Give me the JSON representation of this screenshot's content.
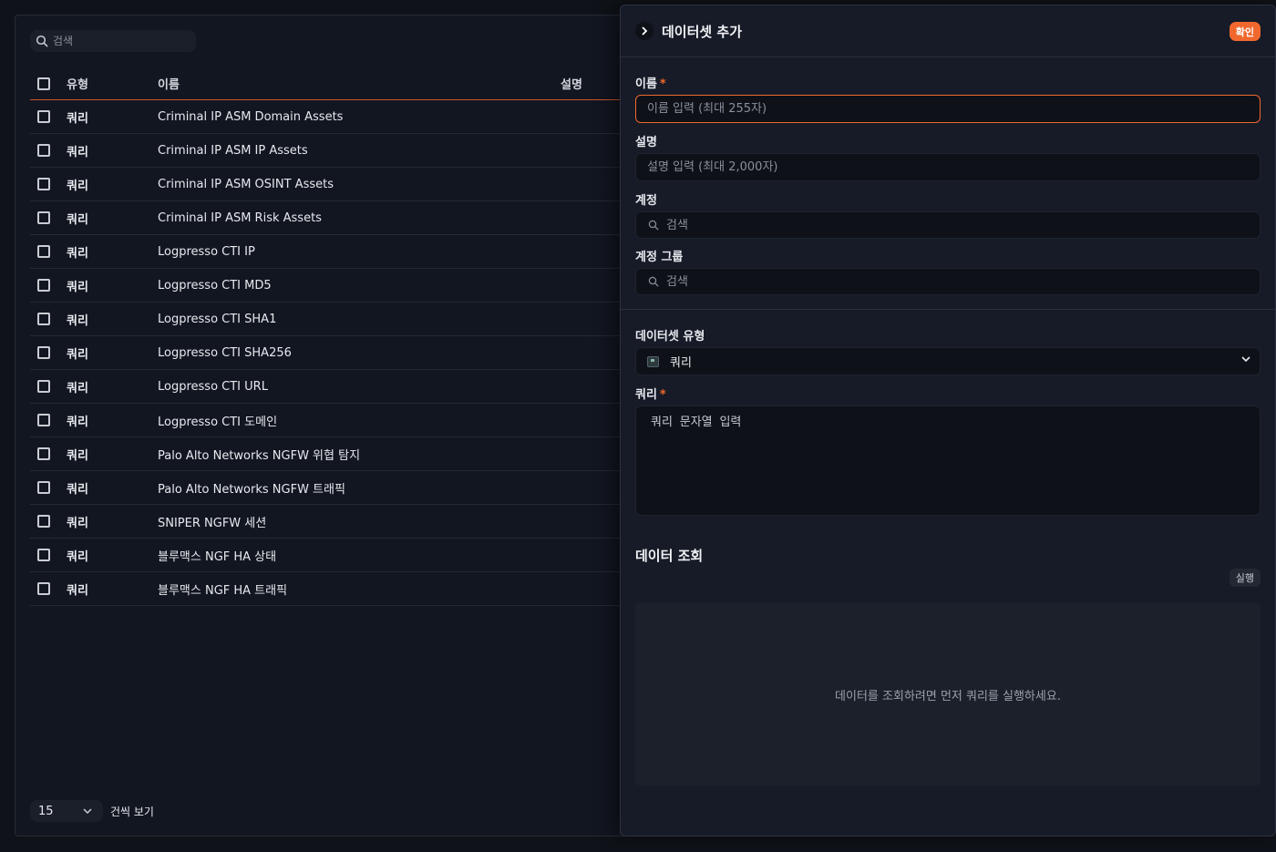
{
  "list": {
    "search_placeholder": "검색",
    "columns": {
      "type": "유형",
      "name": "이름",
      "description": "설명"
    },
    "rows": [
      {
        "type": "쿼리",
        "name": "Criminal IP ASM Domain Assets",
        "description": ""
      },
      {
        "type": "쿼리",
        "name": "Criminal IP ASM IP Assets",
        "description": ""
      },
      {
        "type": "쿼리",
        "name": "Criminal IP ASM OSINT Assets",
        "description": ""
      },
      {
        "type": "쿼리",
        "name": "Criminal IP ASM Risk Assets",
        "description": ""
      },
      {
        "type": "쿼리",
        "name": "Logpresso CTI IP",
        "description": ""
      },
      {
        "type": "쿼리",
        "name": "Logpresso CTI MD5",
        "description": ""
      },
      {
        "type": "쿼리",
        "name": "Logpresso CTI SHA1",
        "description": ""
      },
      {
        "type": "쿼리",
        "name": "Logpresso CTI SHA256",
        "description": ""
      },
      {
        "type": "쿼리",
        "name": "Logpresso CTI URL",
        "description": ""
      },
      {
        "type": "쿼리",
        "name": "Logpresso CTI 도메인",
        "description": ""
      },
      {
        "type": "쿼리",
        "name": "Palo Alto Networks NGFW 위협 탐지",
        "description": ""
      },
      {
        "type": "쿼리",
        "name": "Palo Alto Networks NGFW 트래픽",
        "description": ""
      },
      {
        "type": "쿼리",
        "name": "SNIPER NGFW 세션",
        "description": ""
      },
      {
        "type": "쿼리",
        "name": "블루맥스 NGF HA 상태",
        "description": ""
      },
      {
        "type": "쿼리",
        "name": "블루맥스 NGF HA 트래픽",
        "description": ""
      }
    ],
    "page_size": "15",
    "page_size_label": "건씩 보기"
  },
  "form": {
    "title": "데이터셋 추가",
    "confirm_label": "확인",
    "name_label": "이름",
    "required_mark": "*",
    "name_placeholder": "이름 입력 (최대 255자)",
    "description_label": "설명",
    "description_placeholder": "설명 입력 (최대 2,000자)",
    "account_label": "계정",
    "account_search_placeholder": "검색",
    "account_group_label": "계정 그룹",
    "account_group_search_placeholder": "검색",
    "dataset_type_label": "데이터셋 유형",
    "dataset_type_value": "쿼리",
    "query_label": "쿼리",
    "query_placeholder": "쿼리 문자열 입력",
    "data_view_title": "데이터 조회",
    "run_label": "실행",
    "empty_result_message": "데이터를 조회하려면 먼저 쿼리를 실행하세요."
  },
  "colors": {
    "accent": "#f0682e",
    "background": "#0f1218",
    "panel": "#161b27"
  },
  "icons": [
    "search-icon",
    "chevron-right-icon",
    "chevron-down-icon",
    "query-icon"
  ]
}
